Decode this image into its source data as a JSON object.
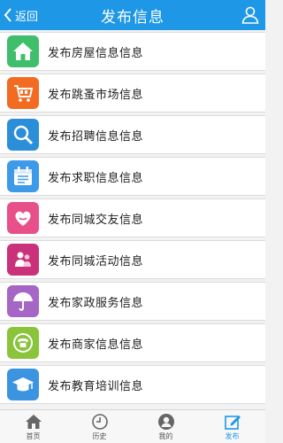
{
  "header": {
    "back_label": "返回",
    "title": "发布信息"
  },
  "menu": [
    {
      "label": "发布房屋信息信息",
      "icon": "house-icon",
      "color": "#3fbf6b"
    },
    {
      "label": "发布跳蚤市场信息",
      "icon": "cart-icon",
      "color": "#f26b21"
    },
    {
      "label": "发布招聘信息信息",
      "icon": "magnifier-icon",
      "color": "#2a8fd8"
    },
    {
      "label": "发布求职信息信息",
      "icon": "calendar-icon",
      "color": "#3d9ae8"
    },
    {
      "label": "发布同城交友信息",
      "icon": "heart-hands-icon",
      "color": "#e8508a"
    },
    {
      "label": "发布同城活动信息",
      "icon": "people-icon",
      "color": "#c9317a"
    },
    {
      "label": "发布家政服务信息",
      "icon": "umbrella-icon",
      "color": "#a566c6"
    },
    {
      "label": "发布商家信息信息",
      "icon": "phone-icon",
      "color": "#8ac43a"
    },
    {
      "label": "发布教育培训信息",
      "icon": "graduation-cap-icon",
      "color": "#3b94e0"
    }
  ],
  "tabs": [
    {
      "label": "首页",
      "icon": "home-icon"
    },
    {
      "label": "历史",
      "icon": "clock-icon"
    },
    {
      "label": "我的",
      "icon": "user-icon"
    },
    {
      "label": "发布",
      "icon": "edit-icon",
      "active": true
    }
  ],
  "colors": {
    "header_bg": "#1e97e6",
    "accent": "#1e97e6"
  }
}
